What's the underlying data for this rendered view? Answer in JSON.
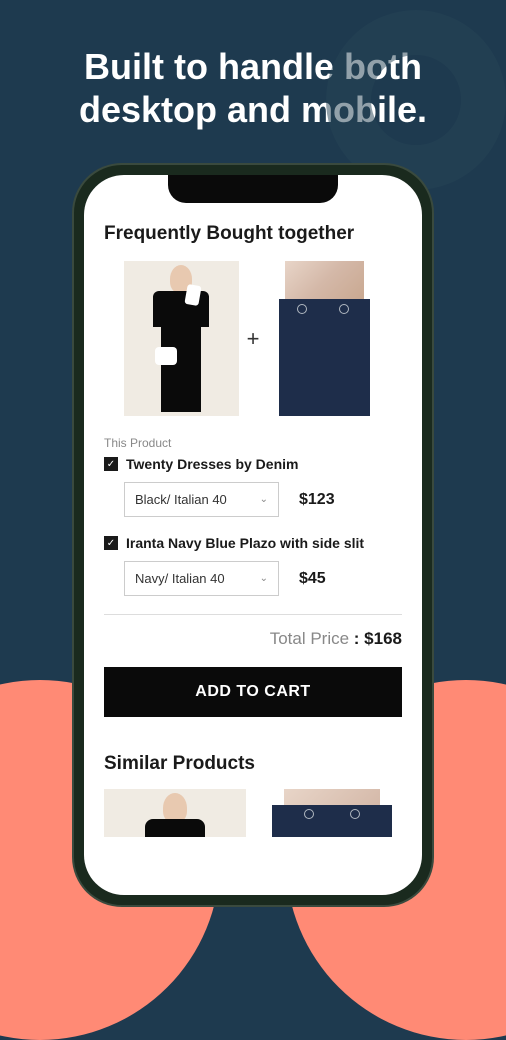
{
  "headline": "Built to handle both desktop and mobile.",
  "section_title": "Frequently Bought together",
  "plus_sign": "+",
  "this_product_label": "This Product",
  "checkmark": "✓",
  "chevron": "⌄",
  "products": [
    {
      "name": "Twenty Dresses by Denim",
      "variant": "Black/ Italian 40",
      "price": "$123"
    },
    {
      "name": "Iranta Navy Blue Plazo with side slit",
      "variant": "Navy/ Italian 40",
      "price": "$45"
    }
  ],
  "total": {
    "label": "Total Price",
    "separator": " : ",
    "value": "$168"
  },
  "add_to_cart_label": "ADD TO CART",
  "similar_title": "Similar Products"
}
